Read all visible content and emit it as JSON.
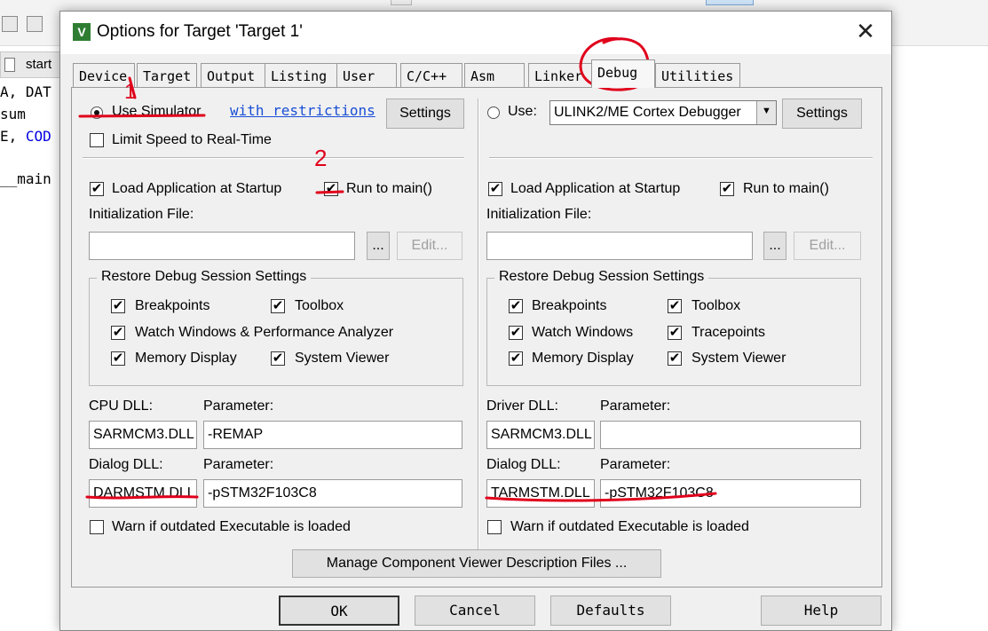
{
  "background": {
    "file_tab": "start",
    "code_lines": [
      {
        "prefix": "A, DAT",
        "kw": ""
      },
      {
        "prefix": "sum",
        "kw": ""
      },
      {
        "prefix": "E, ",
        "kw": "COD"
      },
      {
        "prefix": "",
        "kw": ""
      },
      {
        "prefix": "__main",
        "kw": ""
      }
    ]
  },
  "dialog": {
    "title": "Options for Target 'Target 1'",
    "app_icon_glyph": "V",
    "close_glyph": "✕",
    "tabs": [
      "Device",
      "Target",
      "Output",
      "Listing",
      "User",
      "C/C++",
      "Asm",
      "Linker",
      "Debug",
      "Utilities"
    ],
    "active_tab": "Debug"
  },
  "left_pane": {
    "use_simulator": "Use Simulator",
    "with_restrictions": "with restrictions",
    "settings": "Settings",
    "limit_speed": "Limit Speed to Real-Time",
    "load_app": "Load Application at Startup",
    "run_to_main": "Run to main()",
    "init_file_label": "Initialization File:",
    "init_file_value": "",
    "browse": "...",
    "edit": "Edit...",
    "restore_title": "Restore Debug Session Settings",
    "restore": {
      "breakpoints": "Breakpoints",
      "toolbox": "Toolbox",
      "watch": "Watch Windows & Performance Analyzer",
      "memory": "Memory Display",
      "system_viewer": "System Viewer"
    },
    "dll_label_1": "CPU DLL:",
    "param_label_1": "Parameter:",
    "dll_value_1": "SARMCM3.DLL",
    "param_value_1": "-REMAP",
    "dll_label_2": "Dialog DLL:",
    "param_label_2": "Parameter:",
    "dll_value_2": "DARMSTM.DLL",
    "param_value_2": "-pSTM32F103C8",
    "warn": "Warn if outdated Executable is loaded"
  },
  "right_pane": {
    "use": "Use:",
    "debugger": "ULINK2/ME Cortex Debugger",
    "settings": "Settings",
    "load_app": "Load Application at Startup",
    "run_to_main": "Run to main()",
    "init_file_label": "Initialization File:",
    "init_file_value": "",
    "browse": "...",
    "edit": "Edit...",
    "restore_title": "Restore Debug Session Settings",
    "restore": {
      "breakpoints": "Breakpoints",
      "toolbox": "Toolbox",
      "watch": "Watch Windows",
      "tracepoints": "Tracepoints",
      "memory": "Memory Display",
      "system_viewer": "System Viewer"
    },
    "dll_label_1": "Driver DLL:",
    "param_label_1": "Parameter:",
    "dll_value_1": "SARMCM3.DLL",
    "param_value_1": "",
    "dll_label_2": "Dialog DLL:",
    "param_label_2": "Parameter:",
    "dll_value_2": "TARMSTM.DLL",
    "param_value_2": "-pSTM32F103C8",
    "warn": "Warn if outdated Executable is loaded"
  },
  "manage_button": "Manage Component Viewer Description Files ...",
  "buttons": {
    "ok": "OK",
    "cancel": "Cancel",
    "defaults": "Defaults",
    "help": "Help"
  },
  "annotations": {
    "color": "#e0001b",
    "mark_1": "1",
    "mark_2": "2"
  },
  "check_glyph": "✔"
}
